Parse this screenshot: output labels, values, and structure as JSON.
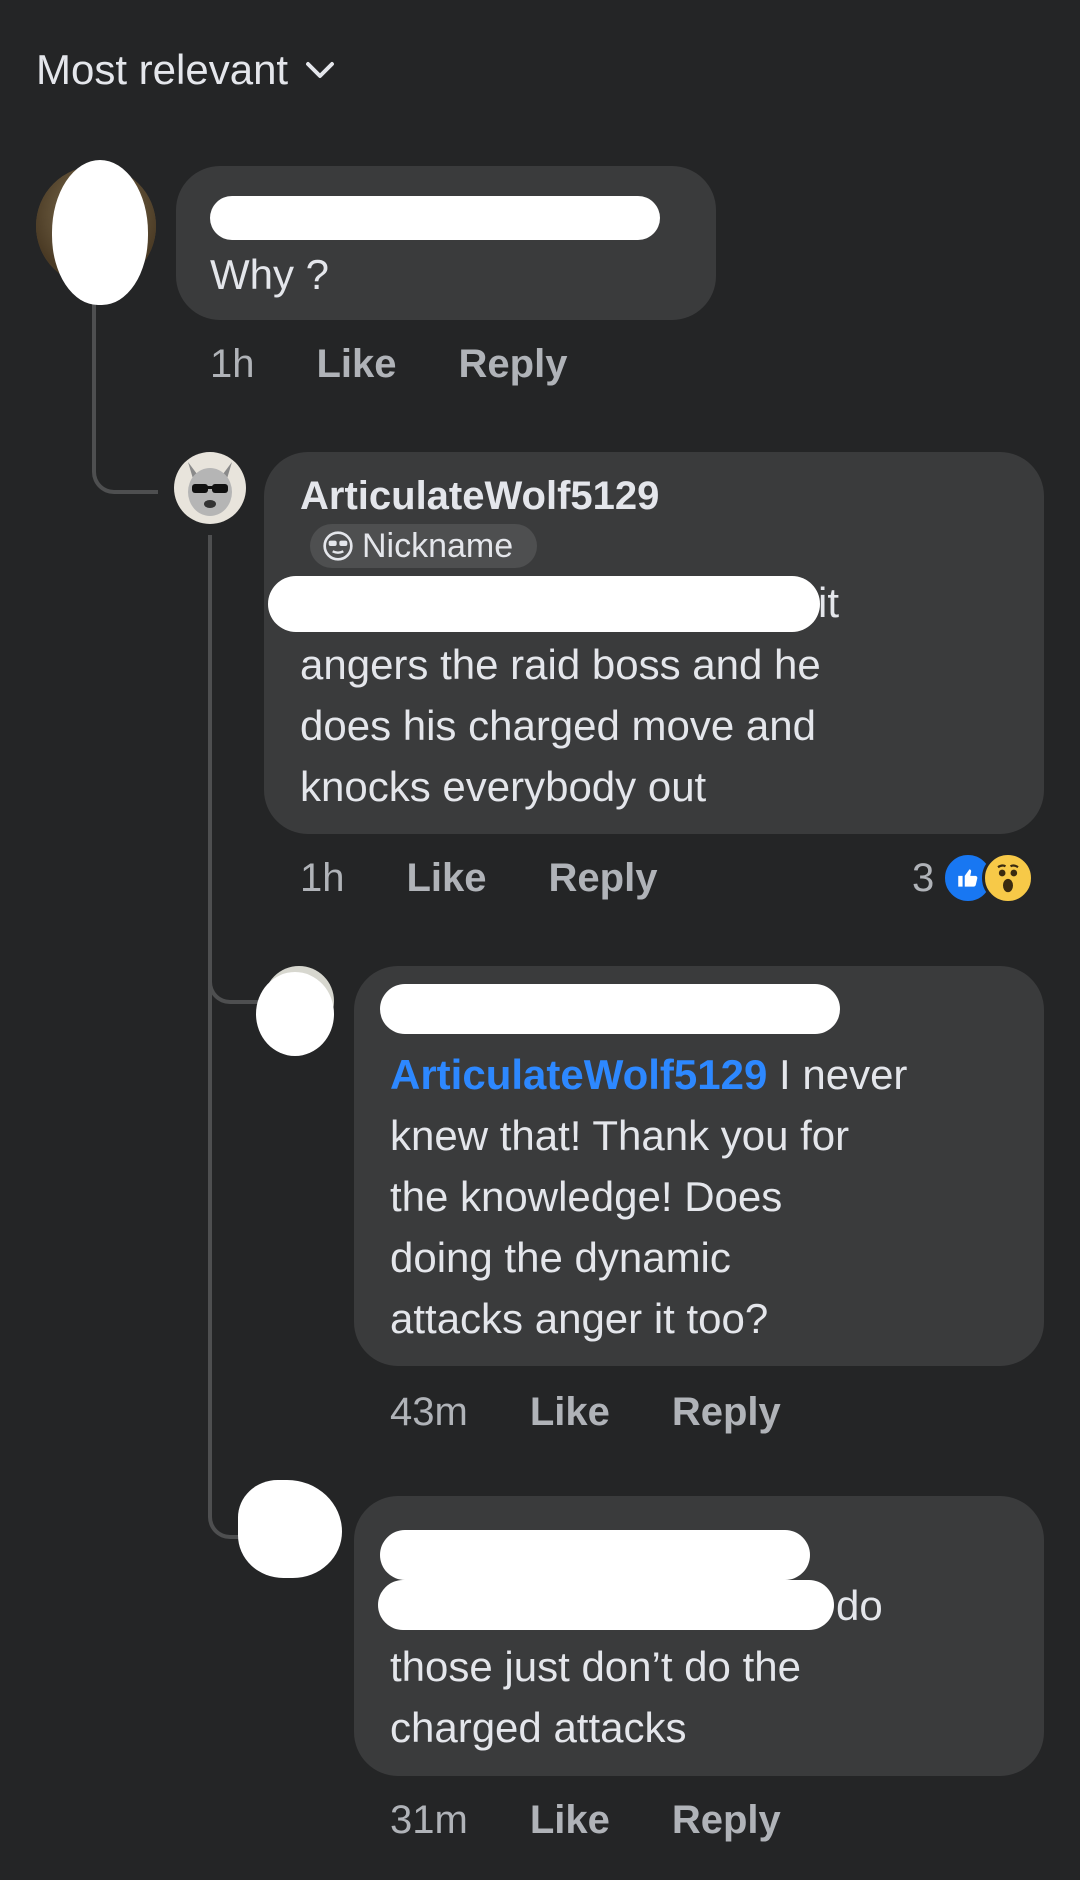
{
  "sort": {
    "label": "Most relevant"
  },
  "comments": [
    {
      "body": "Why ?",
      "time": "1h",
      "like": "Like",
      "reply": "Reply"
    },
    {
      "author": "ArticulateWolf5129",
      "badge": "Nickname",
      "body_tail": "it",
      "body": "angers the raid boss and he\ndoes his charged move and\nknocks everybody out",
      "time": "1h",
      "like": "Like",
      "reply": "Reply",
      "reaction_count": "3",
      "reaction_icons": [
        "like-icon",
        "wow-icon"
      ]
    },
    {
      "mention": "ArticulateWolf5129",
      "body_first": " I never",
      "body": "knew that! Thank you for\nthe knowledge! Does\ndoing the dynamic\nattacks anger it too?",
      "time": "43m",
      "like": "Like",
      "reply": "Reply"
    },
    {
      "body_tail": "do",
      "body": "those just don’t do the\ncharged attacks",
      "time": "31m",
      "like": "Like",
      "reply": "Reply"
    }
  ],
  "colors": {
    "background": "#242526",
    "bubble": "#3a3b3c",
    "text": "#e4e6eb",
    "meta": "#b0b3b8",
    "mention": "#2d88ff",
    "like_reaction": "#1877f2"
  }
}
